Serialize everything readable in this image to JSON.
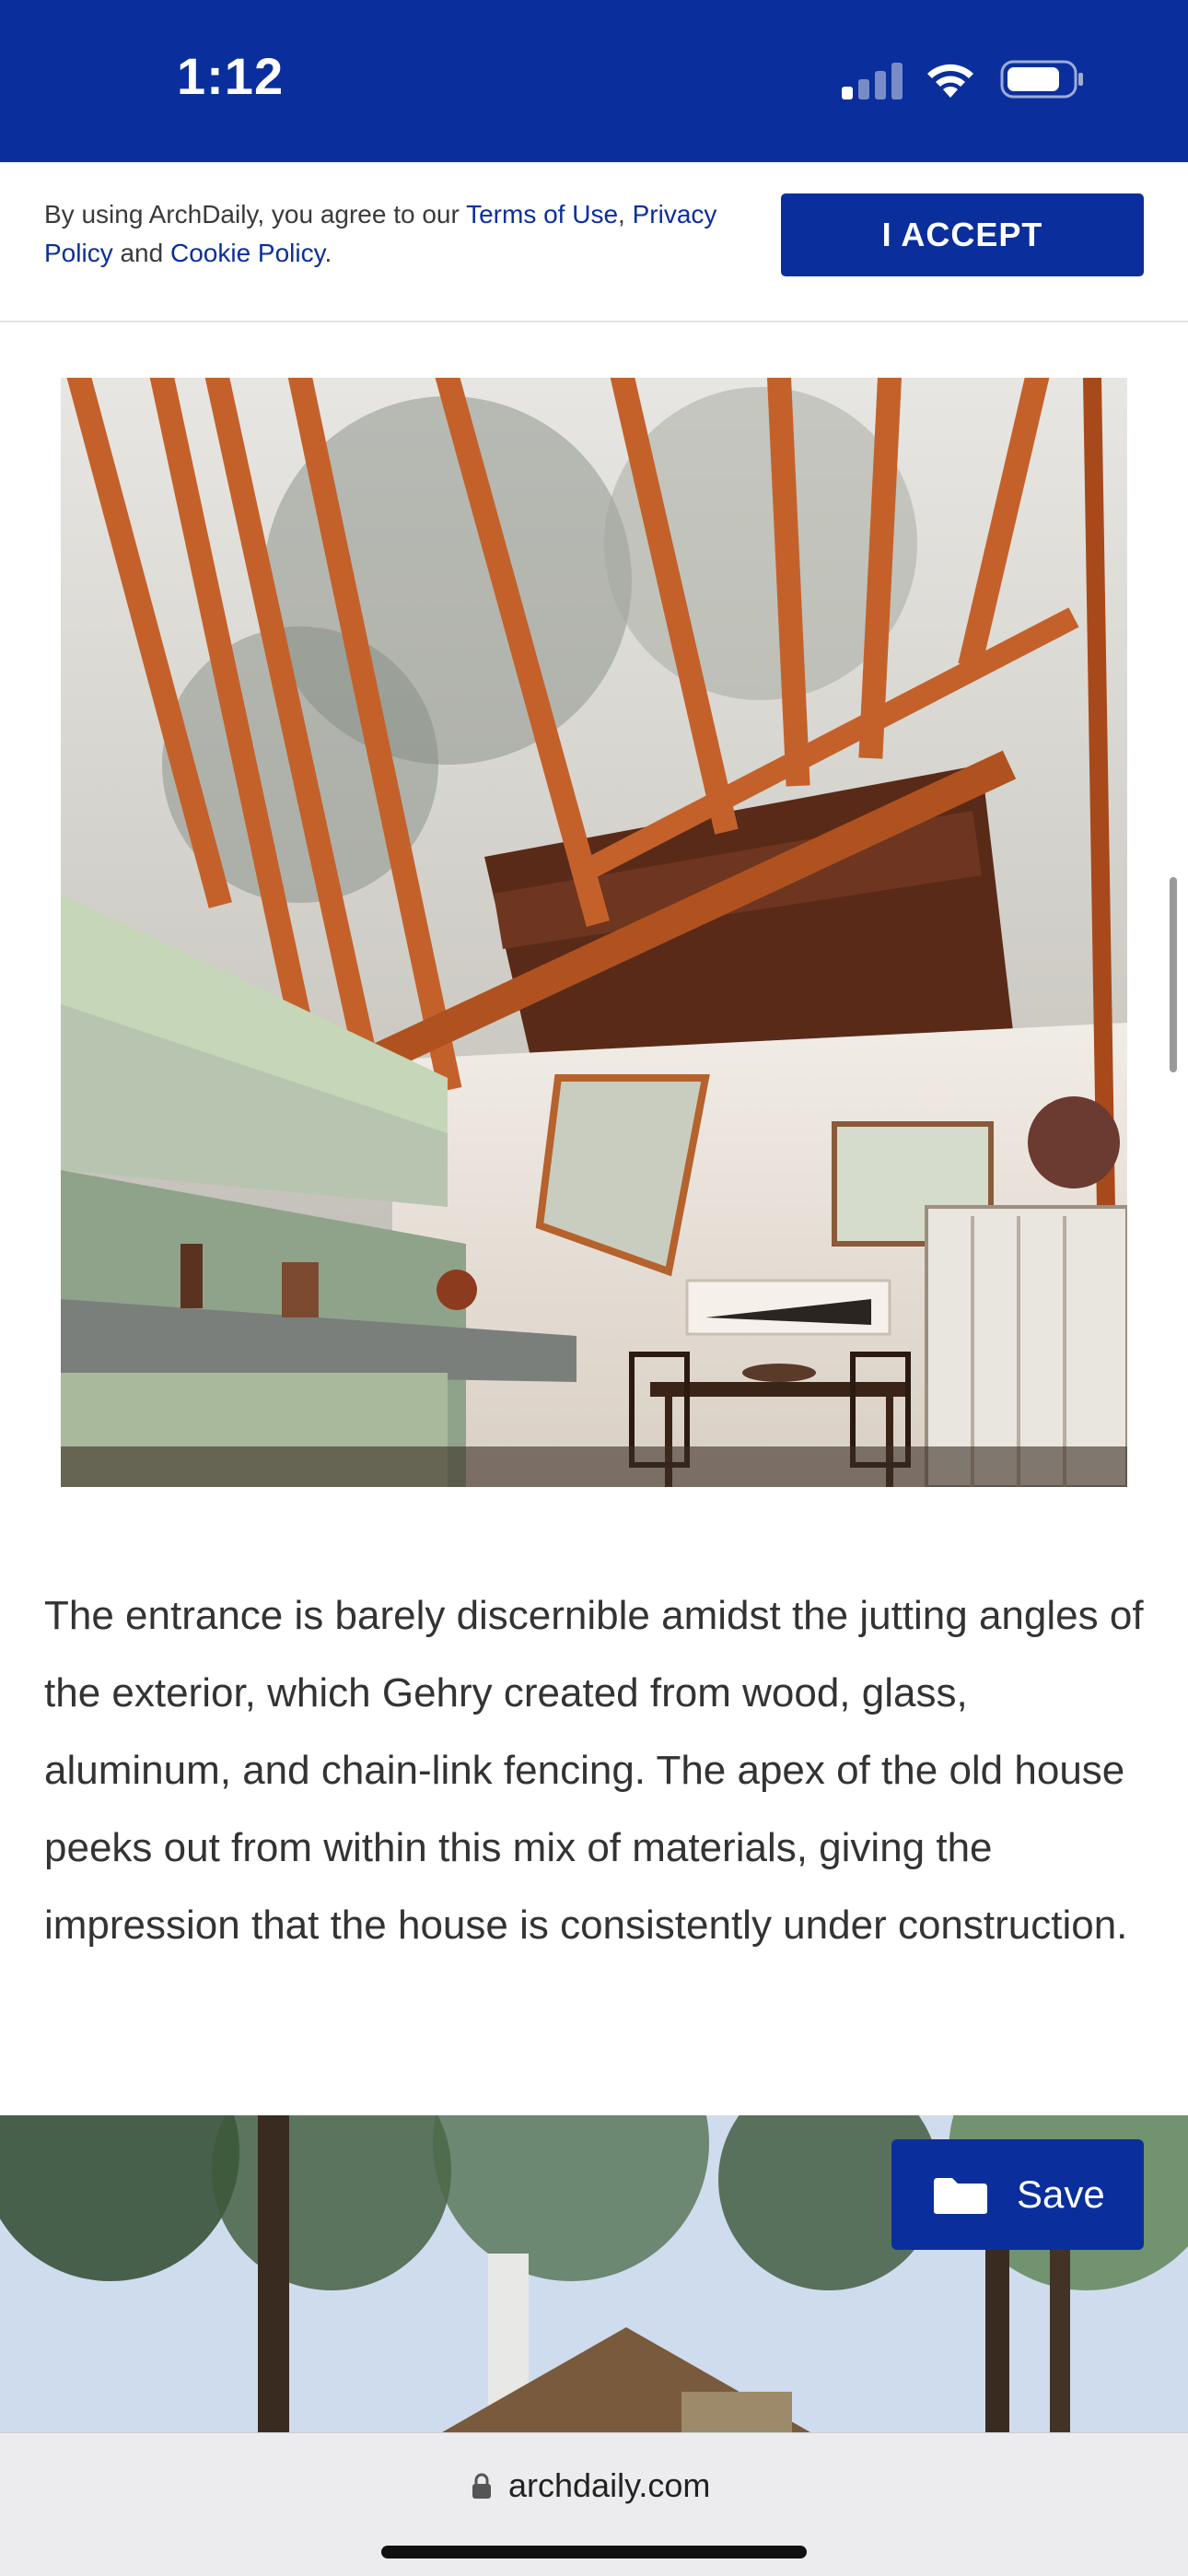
{
  "status_bar": {
    "time": "1:12",
    "signal_icon": "cellular-signal-icon",
    "wifi_icon": "wifi-icon",
    "battery_icon": "battery-icon",
    "background_color": "#0a2f9c"
  },
  "cookie_banner": {
    "text_prefix": "By using ArchDaily, you agree to our ",
    "terms_link": "Terms of Use",
    "comma": ", ",
    "privacy_link": "Privacy Policy",
    "and_text": " and ",
    "cookie_link": "Cookie Policy",
    "period": ".",
    "accept_label": "I ACCEPT",
    "accent_color": "#0a2f9c"
  },
  "article": {
    "paragraph": "The entrance is barely discernible amidst the jutting angles of the exterior, which Gehry created from wood, glass, aluminum, and chain-link fencing. The apex of the old house peeks out from within this mix of materials, giving the impression that the house is consistently under construction."
  },
  "save_button": {
    "label": "Save",
    "icon": "folder-icon"
  },
  "url_bar": {
    "domain": "archdaily.com",
    "icon": "lock-icon"
  }
}
